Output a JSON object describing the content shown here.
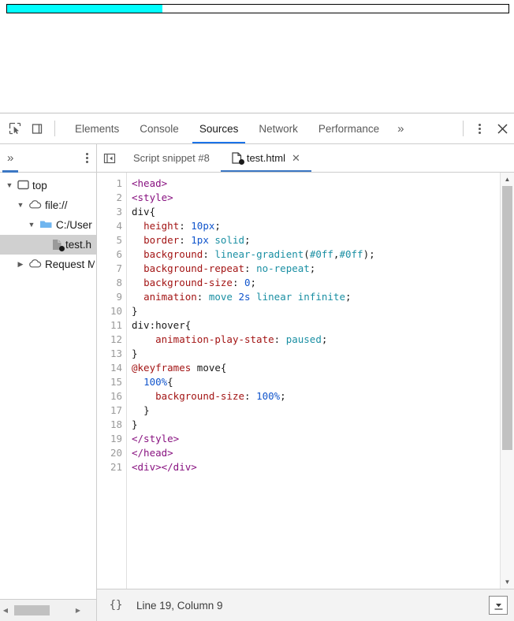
{
  "page_viewport": {
    "animated_bar": {
      "name": "animated progress div",
      "fill_color": "#00ffff",
      "border_color": "#000000",
      "height_px": "10px",
      "fill_percent": 31
    }
  },
  "devtools": {
    "main_toolbar": {
      "inspect_icon": "inspect-element-icon",
      "device_icon": "device-toolbar-icon",
      "panels": [
        {
          "label": "Elements",
          "active": false
        },
        {
          "label": "Console",
          "active": false
        },
        {
          "label": "Sources",
          "active": true
        },
        {
          "label": "Network",
          "active": false
        },
        {
          "label": "Performance",
          "active": false
        }
      ],
      "more_panels_label": "»",
      "menu_icon": "kebab-menu-icon",
      "close_label": "✕"
    },
    "sub_toolbar": {
      "nav_more_tabs_label": "»",
      "nav_menu_icon": "kebab-menu-icon",
      "navigator_toggle_icon": "hide-navigator-icon",
      "editor_tabs": [
        {
          "label": "Script snippet #8",
          "active": false,
          "has_icon": false,
          "closable": false,
          "dirty": false
        },
        {
          "label": "test.html",
          "active": true,
          "has_icon": true,
          "closable": true,
          "dirty": true,
          "close_label": "✕"
        }
      ]
    },
    "navigator": {
      "tree": [
        {
          "label": "top",
          "indent": 0,
          "expanded": true,
          "icon": "frame-icon",
          "selected": false
        },
        {
          "label": "file://",
          "indent": 1,
          "expanded": true,
          "icon": "cloud-icon",
          "selected": false
        },
        {
          "label": "C:/User",
          "indent": 2,
          "expanded": true,
          "icon": "folder-icon",
          "selected": false
        },
        {
          "label": "test.h",
          "indent": 3,
          "expanded": null,
          "icon": "file-icon",
          "selected": true
        },
        {
          "label": "Request M",
          "indent": 1,
          "expanded": false,
          "icon": "cloud-icon",
          "selected": false
        }
      ],
      "hscrollbar": {
        "left_arrow": "◀",
        "right_arrow": "▶"
      }
    },
    "editor": {
      "line_numbers": [
        1,
        2,
        3,
        4,
        5,
        6,
        7,
        8,
        9,
        10,
        11,
        12,
        13,
        14,
        15,
        16,
        17,
        18,
        19,
        20,
        21
      ],
      "code_lines": [
        [
          {
            "t": "tag",
            "s": "<head>"
          }
        ],
        [
          {
            "t": "tag",
            "s": "<style>"
          }
        ],
        [
          {
            "t": "sel",
            "s": "div{"
          }
        ],
        [
          {
            "t": "plain",
            "s": "  "
          },
          {
            "t": "prop",
            "s": "height"
          },
          {
            "t": "punct",
            "s": ": "
          },
          {
            "t": "num",
            "s": "10px"
          },
          {
            "t": "punct",
            "s": ";"
          }
        ],
        [
          {
            "t": "plain",
            "s": "  "
          },
          {
            "t": "prop",
            "s": "border"
          },
          {
            "t": "punct",
            "s": ": "
          },
          {
            "t": "num",
            "s": "1px"
          },
          {
            "t": "plain",
            "s": " "
          },
          {
            "t": "val",
            "s": "solid"
          },
          {
            "t": "punct",
            "s": ";"
          }
        ],
        [
          {
            "t": "plain",
            "s": "  "
          },
          {
            "t": "prop",
            "s": "background"
          },
          {
            "t": "punct",
            "s": ": "
          },
          {
            "t": "val",
            "s": "linear-gradient"
          },
          {
            "t": "punct",
            "s": "("
          },
          {
            "t": "val",
            "s": "#0ff"
          },
          {
            "t": "punct",
            "s": ","
          },
          {
            "t": "val",
            "s": "#0ff"
          },
          {
            "t": "punct",
            "s": ");"
          }
        ],
        [
          {
            "t": "plain",
            "s": "  "
          },
          {
            "t": "prop",
            "s": "background-repeat"
          },
          {
            "t": "punct",
            "s": ": "
          },
          {
            "t": "val",
            "s": "no-repeat"
          },
          {
            "t": "punct",
            "s": ";"
          }
        ],
        [
          {
            "t": "plain",
            "s": "  "
          },
          {
            "t": "prop",
            "s": "background-size"
          },
          {
            "t": "punct",
            "s": ": "
          },
          {
            "t": "num",
            "s": "0"
          },
          {
            "t": "punct",
            "s": ";"
          }
        ],
        [
          {
            "t": "plain",
            "s": "  "
          },
          {
            "t": "prop",
            "s": "animation"
          },
          {
            "t": "punct",
            "s": ": "
          },
          {
            "t": "val",
            "s": "move"
          },
          {
            "t": "plain",
            "s": " "
          },
          {
            "t": "num",
            "s": "2s"
          },
          {
            "t": "plain",
            "s": " "
          },
          {
            "t": "val",
            "s": "linear"
          },
          {
            "t": "plain",
            "s": " "
          },
          {
            "t": "val",
            "s": "infinite"
          },
          {
            "t": "punct",
            "s": ";"
          }
        ],
        [
          {
            "t": "punct",
            "s": "}"
          }
        ],
        [
          {
            "t": "sel",
            "s": "div:hover{"
          }
        ],
        [
          {
            "t": "plain",
            "s": "    "
          },
          {
            "t": "prop",
            "s": "animation-play-state"
          },
          {
            "t": "punct",
            "s": ": "
          },
          {
            "t": "val",
            "s": "paused"
          },
          {
            "t": "punct",
            "s": ";"
          }
        ],
        [
          {
            "t": "punct",
            "s": "}"
          }
        ],
        [
          {
            "t": "at",
            "s": "@keyframes"
          },
          {
            "t": "plain",
            "s": " "
          },
          {
            "t": "sel",
            "s": "move{"
          }
        ],
        [
          {
            "t": "plain",
            "s": "  "
          },
          {
            "t": "num",
            "s": "100%"
          },
          {
            "t": "punct",
            "s": "{"
          }
        ],
        [
          {
            "t": "plain",
            "s": "    "
          },
          {
            "t": "prop",
            "s": "background-size"
          },
          {
            "t": "punct",
            "s": ": "
          },
          {
            "t": "num",
            "s": "100%"
          },
          {
            "t": "punct",
            "s": ";"
          }
        ],
        [
          {
            "t": "plain",
            "s": "  "
          },
          {
            "t": "punct",
            "s": "}"
          }
        ],
        [
          {
            "t": "punct",
            "s": "}"
          }
        ],
        [
          {
            "t": "tag",
            "s": "</style>"
          }
        ],
        [
          {
            "t": "tag",
            "s": "</head>"
          }
        ],
        [
          {
            "t": "tag",
            "s": "<div></div>"
          }
        ]
      ],
      "vscrollbar": {
        "up_arrow": "▲",
        "down_arrow": "▼"
      }
    },
    "status_bar": {
      "pretty_print_label": "{}",
      "cursor_position": "Line 19, Column 9",
      "drawer_toggle_icon": "show-drawer-icon"
    }
  }
}
